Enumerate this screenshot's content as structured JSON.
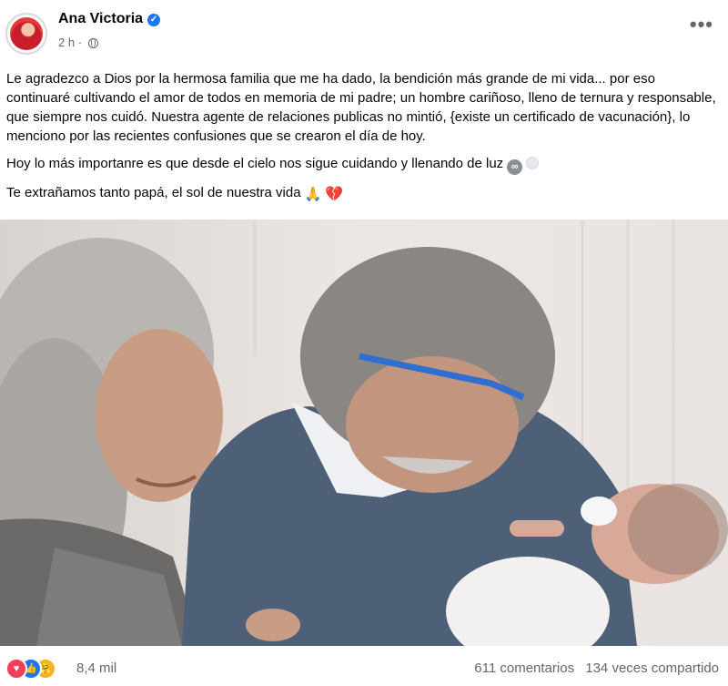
{
  "post": {
    "author": "Ana Victoria",
    "timestamp": "2 h",
    "separator": "·",
    "more_label": "•••",
    "verified_icon": "verified-badge-icon",
    "privacy_icon": "globe-icon",
    "paragraphs": {
      "p1": "Le agradezco a Dios por la hermosa familia que me ha dado, la bendición más grande de mi vida...  por eso continuaré cultivando el amor de todos en memoria de mi padre; un hombre cariñoso, lleno de ternura y responsable, que siempre nos cuidó. Nuestra agente de relaciones publicas no mintió, {existe un certificado de vacunación}, lo menciono por las recientes confusiones que se crearon el día de hoy.",
      "p2": "Hoy lo más importanre es que desde el cielo nos sigue cuidando y llenando de luz",
      "p3": "Te extrañamos tanto papá, el sol de nuestra vida"
    },
    "emojis": {
      "infinity": "∞",
      "pray": "🙏",
      "broken_heart": "💔"
    }
  },
  "reactions": {
    "types": [
      "love",
      "like",
      "care"
    ],
    "love_glyph": "♥",
    "like_glyph": "👍",
    "care_glyph": "🤗",
    "count": "8,4 mil"
  },
  "stats": {
    "comments": "611 comentarios",
    "shares": "134 veces compartido"
  },
  "colors": {
    "verified": "#1877f2",
    "secondary_text": "#65676b",
    "love": "#f33e58",
    "like": "#1877f2",
    "care": "#f7b125"
  }
}
